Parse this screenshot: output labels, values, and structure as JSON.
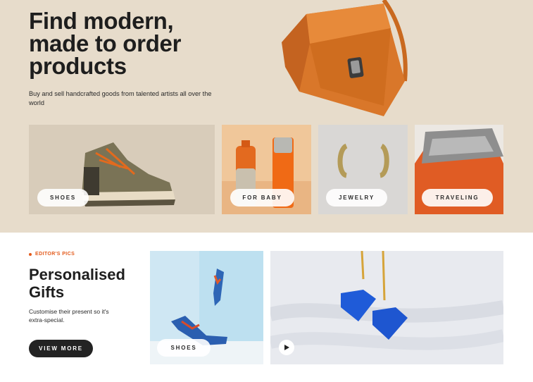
{
  "hero": {
    "title_lines": [
      "Find modern,",
      "made to order",
      "products"
    ],
    "subtitle": "Buy and sell handcrafted goods from talented artists all over the world"
  },
  "categories": [
    {
      "label": "SHOES",
      "icon": "shoe-image"
    },
    {
      "label": "FOR BABY",
      "icon": "bottle-image"
    },
    {
      "label": "JEWELRY",
      "icon": "earring-image"
    },
    {
      "label": "TRAVELING",
      "icon": "flask-image"
    }
  ],
  "editors": {
    "label": "EDITOR'S PICS",
    "title_lines": [
      "Personalised",
      "Gifts"
    ],
    "description": "Customise their present so it's extra-special.",
    "button_label": "VIEW MORE",
    "picks": [
      {
        "label": "SHOES",
        "icon": "heels-image"
      },
      {
        "label": "",
        "icon": "play-icon"
      }
    ]
  },
  "colors": {
    "hero_bg": "#e7dccb",
    "accent": "#e35b1c",
    "button_dark": "#232323"
  }
}
